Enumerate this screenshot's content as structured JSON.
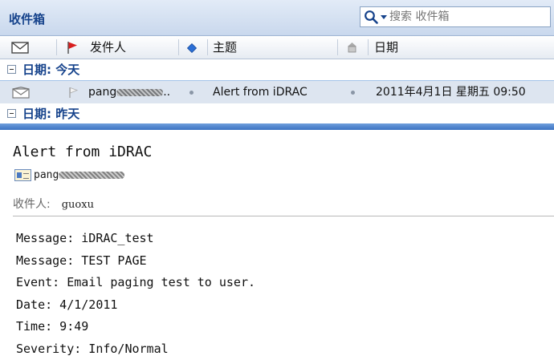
{
  "inbox": {
    "title": "收件箱",
    "search": {
      "placeholder": "搜索 收件箱",
      "value": ""
    }
  },
  "columns": {
    "sender": "发件人",
    "subject": "主题",
    "date": "日期"
  },
  "groups": [
    {
      "label": "日期: 今天",
      "messages": [
        {
          "sender": "pang",
          "sender_tail": "..",
          "subject": "Alert from iDRAC",
          "date": "2011年4月1日 星期五 09:50"
        }
      ]
    },
    {
      "label": "日期: 昨天",
      "messages": []
    }
  ],
  "reader": {
    "subject": "Alert from iDRAC",
    "from": "pang",
    "to_label": "收件人:",
    "to": "guoxu",
    "body": [
      "Message: iDRAC_test",
      "Message: TEST PAGE",
      "Event: Email paging test to user.",
      "Date: 4/1/2011",
      "Time: 9:49",
      "Severity: Info/Normal"
    ]
  },
  "icons": {
    "flag_color": "#d81e1e",
    "group_label_color": "#15428b",
    "splitter_color": "#3b72c2"
  }
}
